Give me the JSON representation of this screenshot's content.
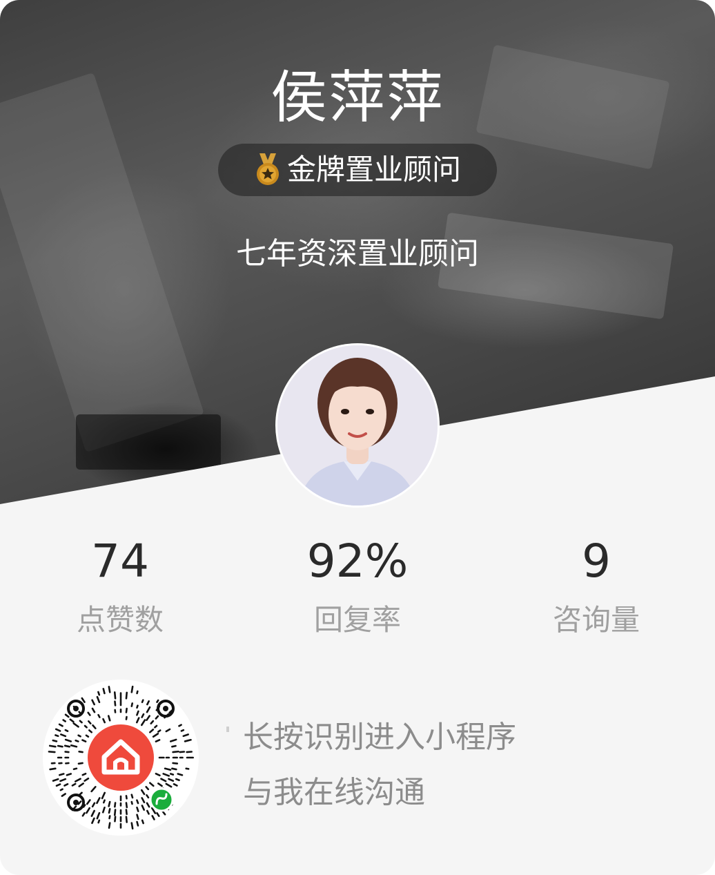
{
  "profile": {
    "name": "侯萍萍",
    "badge_label": "金牌置业顾问",
    "tagline": "七年资深置业顾问"
  },
  "stats": [
    {
      "value": "74",
      "label": "点赞数"
    },
    {
      "value": "92%",
      "label": "回复率"
    },
    {
      "value": "9",
      "label": "咨询量"
    }
  ],
  "qr": {
    "line1": "长按识别进入小程序",
    "line2": "与我在线沟通"
  },
  "icons": {
    "medal": "medal-icon",
    "house": "house-icon",
    "mini_program": "mini-program-icon"
  },
  "colors": {
    "brand_red": "#ef4a3c",
    "medal_gold": "#c98a1d",
    "mini_program_green": "#1aad3c"
  }
}
